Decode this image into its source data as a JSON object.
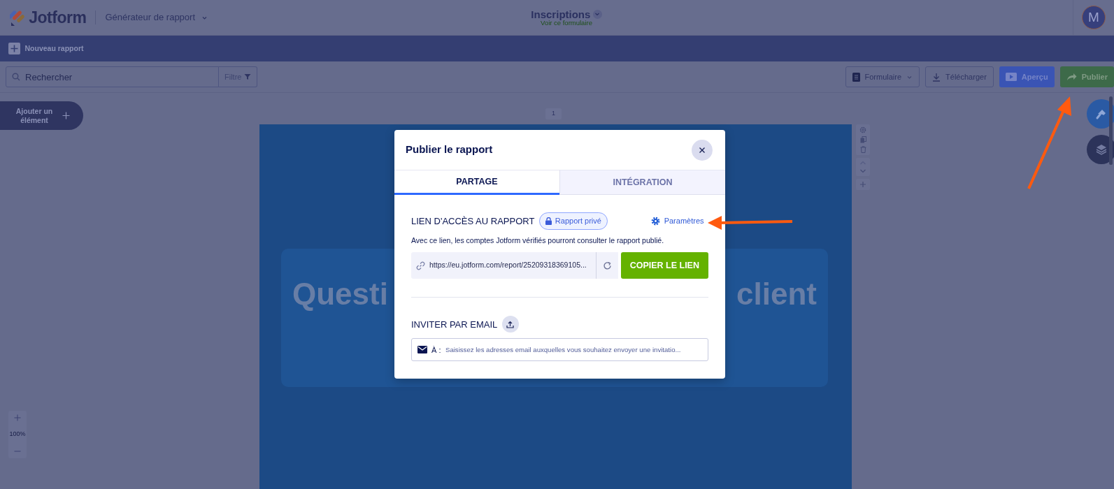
{
  "header": {
    "logo_text": "Jotform",
    "app_menu": "Générateur de rapport",
    "form_title": "Inscriptions",
    "form_link": "Voir ce formulaire",
    "avatar": "M"
  },
  "action_bar": {
    "new_report": "Nouveau rapport"
  },
  "toolbar": {
    "search": {
      "placeholder": "Rechercher"
    },
    "filter": "Filtre",
    "buttons": [
      {
        "label": "Formulaire",
        "kind": "form"
      },
      {
        "label": "Télécharger",
        "kind": "download"
      },
      {
        "label": "Aperçu",
        "kind": "preview"
      },
      {
        "label": "Publier",
        "kind": "publish"
      }
    ]
  },
  "canvas": {
    "add_element": "Ajouter un élément",
    "page_number": "1",
    "report_title_fragments": [
      "Questi",
      "client"
    ],
    "zoom_level": "100%"
  },
  "modal": {
    "title": "Publier le rapport",
    "tabs": [
      {
        "label": "PARTAGE",
        "selected": true
      },
      {
        "label": "INTÉGRATION",
        "selected": false
      }
    ],
    "link_section": {
      "title": "LIEN D'ACCÈS AU RAPPORT",
      "privacy_badge": "Rapport privé",
      "settings_link": "Paramètres",
      "description": "Avec ce lien, les comptes Jotform vérifiés pourront consulter le rapport publié.",
      "link": "https://eu.jotform.com/report/25209318369105...",
      "copy_button": "COPIER LE LIEN"
    },
    "invite_section": {
      "title": "INVITER PAR EMAIL",
      "to_label": "À :",
      "placeholder": "Saisissez les adresses email auxquelles vous souhaitez envoyer une invitatio..."
    }
  }
}
